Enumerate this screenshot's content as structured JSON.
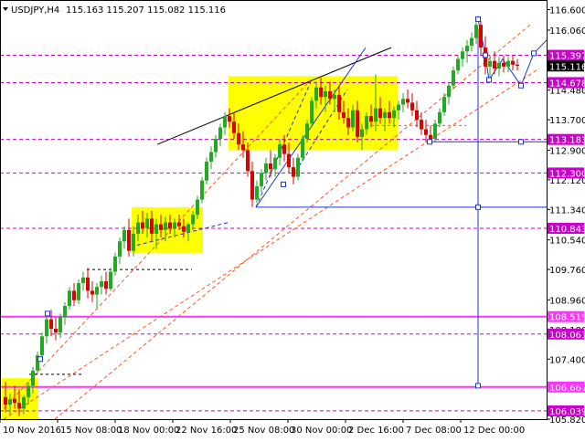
{
  "header": {
    "symbol": "USDJPY,H4",
    "quotes": "115.163 115.207 115.082 115.116"
  },
  "colors": {
    "bull": "#22aa22",
    "bear": "#dd0000",
    "level_dashed": "#cc00cc",
    "level_solid": "#ff33ff",
    "channel": "#ff5522",
    "projection": "#1a35d6",
    "trendline": "#000000",
    "zone": "#ffff00",
    "price_tag_dark": "#1a35d6",
    "price_tag_black": "#000000"
  },
  "chart_data": {
    "type": "candlestick",
    "title": "USDJPY,H4",
    "ylim": [
      105.82,
      116.42
    ],
    "xlim": [
      0,
      590
    ],
    "y_ticks": [
      "116.600",
      "116.060",
      "115.300",
      "114.480",
      "113.700",
      "112.900",
      "112.120",
      "111.340",
      "110.540",
      "109.760",
      "108.960",
      "108.180",
      "107.400",
      "106.620",
      "105.820"
    ],
    "x_ticks": [
      {
        "label": "10 Nov 2016",
        "x": 0
      },
      {
        "label": "15 Nov 08:00",
        "x": 63
      },
      {
        "label": "18 Nov 00:00",
        "x": 126
      },
      {
        "label": "22 Nov 16:00",
        "x": 189
      },
      {
        "label": "25 Nov 08:00",
        "x": 252
      },
      {
        "label": "30 Nov 00:00",
        "x": 315
      },
      {
        "label": "2 Dec 16:00",
        "x": 378
      },
      {
        "label": "7 Dec 08:00",
        "x": 441
      },
      {
        "label": "12 Dec 00:00",
        "x": 504
      }
    ],
    "levels": [
      {
        "price": "115.397",
        "style": "dashed",
        "tag": "dark"
      },
      {
        "price": "114.678",
        "style": "dashed",
        "tag": "dark"
      },
      {
        "price": "113.183",
        "style": "dashed",
        "tag": "dark"
      },
      {
        "price": "112.300",
        "style": "dashed",
        "tag": "dark"
      },
      {
        "price": "110.843",
        "style": "dashed",
        "tag": "dark"
      },
      {
        "price": "108.519",
        "style": "solid",
        "tag": "dark"
      },
      {
        "price": "108.061",
        "style": "dashed",
        "tag": "dark"
      },
      {
        "price": "106.667",
        "style": "solid",
        "tag": "dark"
      },
      {
        "price": "106.039",
        "style": "dashed",
        "tag": "dark"
      }
    ],
    "current_price": "115.116",
    "candles": [
      {
        "x": 6,
        "o": 106.4,
        "h": 106.8,
        "l": 106.0,
        "c": 106.2
      },
      {
        "x": 11,
        "o": 106.2,
        "h": 106.5,
        "l": 105.95,
        "c": 106.35
      },
      {
        "x": 16,
        "o": 106.35,
        "h": 106.7,
        "l": 106.1,
        "c": 106.25
      },
      {
        "x": 21,
        "o": 106.25,
        "h": 106.6,
        "l": 105.9,
        "c": 106.1
      },
      {
        "x": 26,
        "o": 106.1,
        "h": 106.45,
        "l": 105.95,
        "c": 106.4
      },
      {
        "x": 31,
        "o": 106.4,
        "h": 106.8,
        "l": 106.2,
        "c": 106.7
      },
      {
        "x": 36,
        "o": 106.7,
        "h": 107.2,
        "l": 106.5,
        "c": 107.1
      },
      {
        "x": 41,
        "o": 107.1,
        "h": 107.6,
        "l": 107.0,
        "c": 107.5
      },
      {
        "x": 46,
        "o": 107.5,
        "h": 108.1,
        "l": 107.4,
        "c": 108.0
      },
      {
        "x": 51,
        "o": 108.0,
        "h": 108.6,
        "l": 107.8,
        "c": 108.45
      },
      {
        "x": 56,
        "o": 108.45,
        "h": 108.7,
        "l": 108.0,
        "c": 108.2
      },
      {
        "x": 61,
        "o": 108.2,
        "h": 108.5,
        "l": 107.9,
        "c": 108.1
      },
      {
        "x": 66,
        "o": 108.1,
        "h": 108.6,
        "l": 107.95,
        "c": 108.5
      },
      {
        "x": 71,
        "o": 108.5,
        "h": 108.9,
        "l": 108.3,
        "c": 108.8
      },
      {
        "x": 76,
        "o": 108.8,
        "h": 109.3,
        "l": 108.7,
        "c": 109.2
      },
      {
        "x": 81,
        "o": 109.2,
        "h": 109.4,
        "l": 108.8,
        "c": 108.95
      },
      {
        "x": 86,
        "o": 108.95,
        "h": 109.5,
        "l": 108.85,
        "c": 109.4
      },
      {
        "x": 91,
        "o": 109.4,
        "h": 109.7,
        "l": 109.2,
        "c": 109.55
      },
      {
        "x": 96,
        "o": 109.55,
        "h": 109.8,
        "l": 109.0,
        "c": 109.2
      },
      {
        "x": 101,
        "o": 109.2,
        "h": 109.45,
        "l": 108.9,
        "c": 109.1
      },
      {
        "x": 106,
        "o": 109.1,
        "h": 109.4,
        "l": 108.75,
        "c": 109.3
      },
      {
        "x": 111,
        "o": 109.3,
        "h": 109.6,
        "l": 109.1,
        "c": 109.45
      },
      {
        "x": 116,
        "o": 109.45,
        "h": 109.7,
        "l": 109.1,
        "c": 109.25
      },
      {
        "x": 121,
        "o": 109.25,
        "h": 109.8,
        "l": 109.2,
        "c": 109.7
      },
      {
        "x": 126,
        "o": 109.7,
        "h": 110.2,
        "l": 109.6,
        "c": 110.1
      },
      {
        "x": 131,
        "o": 110.1,
        "h": 110.6,
        "l": 109.9,
        "c": 110.5
      },
      {
        "x": 136,
        "o": 110.5,
        "h": 110.9,
        "l": 110.3,
        "c": 110.8
      },
      {
        "x": 141,
        "o": 110.8,
        "h": 111.1,
        "l": 110.1,
        "c": 110.25
      },
      {
        "x": 146,
        "o": 110.25,
        "h": 110.9,
        "l": 110.1,
        "c": 110.7
      },
      {
        "x": 151,
        "o": 110.7,
        "h": 111.2,
        "l": 110.5,
        "c": 111.0
      },
      {
        "x": 156,
        "o": 111.0,
        "h": 111.3,
        "l": 110.7,
        "c": 110.85
      },
      {
        "x": 161,
        "o": 110.85,
        "h": 111.25,
        "l": 110.6,
        "c": 111.1
      },
      {
        "x": 166,
        "o": 111.1,
        "h": 111.3,
        "l": 110.5,
        "c": 110.7
      },
      {
        "x": 171,
        "o": 110.7,
        "h": 111.1,
        "l": 110.3,
        "c": 110.95
      },
      {
        "x": 176,
        "o": 110.95,
        "h": 111.2,
        "l": 110.6,
        "c": 110.8
      },
      {
        "x": 181,
        "o": 110.8,
        "h": 111.15,
        "l": 110.5,
        "c": 111.0
      },
      {
        "x": 186,
        "o": 111.0,
        "h": 111.2,
        "l": 110.7,
        "c": 110.85
      },
      {
        "x": 191,
        "o": 110.85,
        "h": 111.1,
        "l": 110.6,
        "c": 111.0
      },
      {
        "x": 196,
        "o": 111.0,
        "h": 111.2,
        "l": 110.8,
        "c": 110.9
      },
      {
        "x": 201,
        "o": 110.9,
        "h": 111.1,
        "l": 110.6,
        "c": 110.75
      },
      {
        "x": 206,
        "o": 110.75,
        "h": 111.0,
        "l": 110.5,
        "c": 110.95
      },
      {
        "x": 211,
        "o": 110.95,
        "h": 111.3,
        "l": 110.8,
        "c": 111.2
      },
      {
        "x": 216,
        "o": 111.2,
        "h": 111.7,
        "l": 111.1,
        "c": 111.6
      },
      {
        "x": 221,
        "o": 111.6,
        "h": 112.2,
        "l": 111.5,
        "c": 112.1
      },
      {
        "x": 226,
        "o": 112.1,
        "h": 112.7,
        "l": 112.0,
        "c": 112.6
      },
      {
        "x": 231,
        "o": 112.6,
        "h": 113.0,
        "l": 112.4,
        "c": 112.85
      },
      {
        "x": 236,
        "o": 112.85,
        "h": 113.3,
        "l": 112.7,
        "c": 113.2
      },
      {
        "x": 241,
        "o": 113.2,
        "h": 113.6,
        "l": 113.0,
        "c": 113.5
      },
      {
        "x": 246,
        "o": 113.5,
        "h": 113.9,
        "l": 113.3,
        "c": 113.8
      },
      {
        "x": 251,
        "o": 113.8,
        "h": 114.0,
        "l": 113.5,
        "c": 113.65
      },
      {
        "x": 256,
        "o": 113.65,
        "h": 113.9,
        "l": 113.2,
        "c": 113.35
      },
      {
        "x": 261,
        "o": 113.35,
        "h": 113.6,
        "l": 112.9,
        "c": 113.05
      },
      {
        "x": 266,
        "o": 113.05,
        "h": 113.4,
        "l": 112.7,
        "c": 112.9
      },
      {
        "x": 271,
        "o": 112.9,
        "h": 113.1,
        "l": 112.2,
        "c": 112.35
      },
      {
        "x": 276,
        "o": 112.35,
        "h": 112.6,
        "l": 111.4,
        "c": 111.6
      },
      {
        "x": 281,
        "o": 111.6,
        "h": 112.1,
        "l": 111.5,
        "c": 111.95
      },
      {
        "x": 286,
        "o": 111.95,
        "h": 112.4,
        "l": 111.8,
        "c": 112.3
      },
      {
        "x": 291,
        "o": 112.3,
        "h": 112.7,
        "l": 112.1,
        "c": 112.55
      },
      {
        "x": 296,
        "o": 112.55,
        "h": 112.9,
        "l": 112.2,
        "c": 112.4
      },
      {
        "x": 301,
        "o": 112.4,
        "h": 112.8,
        "l": 112.2,
        "c": 112.7
      },
      {
        "x": 306,
        "o": 112.7,
        "h": 113.2,
        "l": 112.5,
        "c": 113.05
      },
      {
        "x": 311,
        "o": 113.05,
        "h": 113.3,
        "l": 112.6,
        "c": 112.8
      },
      {
        "x": 316,
        "o": 112.8,
        "h": 113.1,
        "l": 112.3,
        "c": 112.45
      },
      {
        "x": 321,
        "o": 112.45,
        "h": 112.7,
        "l": 112.0,
        "c": 112.2
      },
      {
        "x": 326,
        "o": 112.2,
        "h": 112.8,
        "l": 112.1,
        "c": 112.7
      },
      {
        "x": 331,
        "o": 112.7,
        "h": 113.3,
        "l": 112.6,
        "c": 113.2
      },
      {
        "x": 336,
        "o": 113.2,
        "h": 113.7,
        "l": 113.1,
        "c": 113.6
      },
      {
        "x": 341,
        "o": 113.6,
        "h": 114.3,
        "l": 113.5,
        "c": 114.2
      },
      {
        "x": 346,
        "o": 114.2,
        "h": 114.7,
        "l": 114.0,
        "c": 114.55
      },
      {
        "x": 351,
        "o": 114.55,
        "h": 114.8,
        "l": 114.1,
        "c": 114.3
      },
      {
        "x": 356,
        "o": 114.3,
        "h": 114.6,
        "l": 113.9,
        "c": 114.45
      },
      {
        "x": 361,
        "o": 114.45,
        "h": 114.7,
        "l": 114.1,
        "c": 114.25
      },
      {
        "x": 366,
        "o": 114.25,
        "h": 114.5,
        "l": 113.9,
        "c": 114.35
      },
      {
        "x": 371,
        "o": 114.35,
        "h": 114.6,
        "l": 113.7,
        "c": 113.9
      },
      {
        "x": 376,
        "o": 113.9,
        "h": 114.2,
        "l": 113.6,
        "c": 113.75
      },
      {
        "x": 381,
        "o": 113.75,
        "h": 114.0,
        "l": 113.3,
        "c": 113.5
      },
      {
        "x": 386,
        "o": 113.5,
        "h": 114.1,
        "l": 113.4,
        "c": 113.95
      },
      {
        "x": 391,
        "o": 113.95,
        "h": 114.2,
        "l": 113.1,
        "c": 113.25
      },
      {
        "x": 396,
        "o": 113.25,
        "h": 113.6,
        "l": 112.9,
        "c": 113.45
      },
      {
        "x": 401,
        "o": 113.45,
        "h": 113.9,
        "l": 113.3,
        "c": 113.8
      },
      {
        "x": 406,
        "o": 113.8,
        "h": 114.1,
        "l": 113.5,
        "c": 113.65
      },
      {
        "x": 411,
        "o": 113.65,
        "h": 114.9,
        "l": 113.4,
        "c": 114.0
      },
      {
        "x": 416,
        "o": 114.0,
        "h": 114.3,
        "l": 113.6,
        "c": 113.75
      },
      {
        "x": 421,
        "o": 113.75,
        "h": 114.0,
        "l": 113.4,
        "c": 113.9
      },
      {
        "x": 426,
        "o": 113.9,
        "h": 114.2,
        "l": 113.6,
        "c": 113.75
      },
      {
        "x": 431,
        "o": 113.75,
        "h": 114.05,
        "l": 113.5,
        "c": 113.95
      },
      {
        "x": 436,
        "o": 113.95,
        "h": 114.2,
        "l": 113.7,
        "c": 114.1
      },
      {
        "x": 441,
        "o": 114.1,
        "h": 114.4,
        "l": 113.9,
        "c": 114.25
      },
      {
        "x": 446,
        "o": 114.25,
        "h": 114.5,
        "l": 114.0,
        "c": 114.15
      },
      {
        "x": 451,
        "o": 114.15,
        "h": 114.4,
        "l": 113.8,
        "c": 113.95
      },
      {
        "x": 456,
        "o": 113.95,
        "h": 114.2,
        "l": 113.5,
        "c": 113.7
      },
      {
        "x": 461,
        "o": 113.7,
        "h": 113.9,
        "l": 113.3,
        "c": 113.45
      },
      {
        "x": 466,
        "o": 113.45,
        "h": 113.7,
        "l": 113.1,
        "c": 113.3
      },
      {
        "x": 471,
        "o": 113.3,
        "h": 113.55,
        "l": 113.05,
        "c": 113.2
      },
      {
        "x": 476,
        "o": 113.2,
        "h": 113.7,
        "l": 113.1,
        "c": 113.6
      },
      {
        "x": 481,
        "o": 113.6,
        "h": 114.0,
        "l": 113.5,
        "c": 113.9
      },
      {
        "x": 486,
        "o": 113.9,
        "h": 114.4,
        "l": 113.8,
        "c": 114.3
      },
      {
        "x": 491,
        "o": 114.3,
        "h": 114.7,
        "l": 114.1,
        "c": 114.6
      },
      {
        "x": 496,
        "o": 114.6,
        "h": 115.1,
        "l": 114.5,
        "c": 115.0
      },
      {
        "x": 501,
        "o": 115.0,
        "h": 115.4,
        "l": 114.9,
        "c": 115.3
      },
      {
        "x": 506,
        "o": 115.3,
        "h": 115.6,
        "l": 115.1,
        "c": 115.5
      },
      {
        "x": 511,
        "o": 115.5,
        "h": 115.8,
        "l": 115.2,
        "c": 115.65
      },
      {
        "x": 516,
        "o": 115.65,
        "h": 116.0,
        "l": 115.5,
        "c": 115.85
      },
      {
        "x": 521,
        "o": 115.85,
        "h": 116.35,
        "l": 115.7,
        "c": 116.2
      },
      {
        "x": 526,
        "o": 116.2,
        "h": 116.3,
        "l": 115.4,
        "c": 115.6
      },
      {
        "x": 531,
        "o": 115.6,
        "h": 115.9,
        "l": 114.9,
        "c": 115.1
      },
      {
        "x": 536,
        "o": 115.1,
        "h": 115.4,
        "l": 114.8,
        "c": 115.25
      },
      {
        "x": 541,
        "o": 115.25,
        "h": 115.5,
        "l": 114.9,
        "c": 115.05
      },
      {
        "x": 546,
        "o": 115.05,
        "h": 115.35,
        "l": 114.85,
        "c": 115.2
      },
      {
        "x": 551,
        "o": 115.2,
        "h": 115.4,
        "l": 114.95,
        "c": 115.1
      },
      {
        "x": 556,
        "o": 115.1,
        "h": 115.35,
        "l": 114.95,
        "c": 115.25
      },
      {
        "x": 561,
        "o": 115.25,
        "h": 115.4,
        "l": 115.0,
        "c": 115.15
      },
      {
        "x": 566,
        "o": 115.15,
        "h": 115.3,
        "l": 115.0,
        "c": 115.12
      }
    ],
    "zones": [
      {
        "x1": 2,
        "x2": 42,
        "p_top": 106.9,
        "p_bot": 105.82
      },
      {
        "x1": 144,
        "x2": 222,
        "p_top": 111.4,
        "p_bot": 110.2
      },
      {
        "x1": 250,
        "x2": 435,
        "p_top": 114.85,
        "p_bot": 112.9
      }
    ],
    "trendlines": [
      {
        "x1": 172,
        "p1": 113.05,
        "x2": 428,
        "p2": 115.6,
        "style": "solid",
        "color": "trendline"
      },
      {
        "x1": 4,
        "p1": 106.1,
        "x2": 340,
        "p2": 114.75,
        "style": "dashed",
        "color": "channel"
      },
      {
        "x1": 4,
        "p1": 105.82,
        "x2": 590,
        "p2": 115.05,
        "style": "dashed",
        "color": "channel"
      },
      {
        "x1": 60,
        "p1": 105.82,
        "x2": 580,
        "p2": 116.2,
        "style": "dashed",
        "color": "channel"
      },
      {
        "x1": 280,
        "p1": 111.4,
        "x2": 400,
        "p2": 115.6,
        "style": "solid",
        "color": "projection"
      },
      {
        "x1": 280,
        "p1": 111.4,
        "x2": 340,
        "p2": 114.7,
        "style": "dashed",
        "color": "projection"
      },
      {
        "x1": 320,
        "p1": 112.2,
        "x2": 380,
        "p2": 114.5,
        "style": "dashed",
        "color": "projection"
      },
      {
        "x1": 150,
        "p1": 110.4,
        "x2": 250,
        "p2": 111.0,
        "style": "dashed",
        "color": "projection"
      }
    ],
    "horizontal_segments": [
      {
        "x1": 32,
        "x2": 90,
        "p": 107.0,
        "style": "dashed",
        "color": "#000000"
      },
      {
        "x1": 95,
        "x2": 210,
        "p": 109.76,
        "style": "dashed",
        "color": "#000000"
      },
      {
        "x1": 280,
        "x2": 598,
        "p": 111.4,
        "style": "solid",
        "color": "projection"
      },
      {
        "x1": 470,
        "x2": 598,
        "p": 113.12,
        "style": "solid",
        "color": "projection"
      },
      {
        "x1": 400,
        "x2": 510,
        "p": 113.55,
        "style": "dashed",
        "color": "channel"
      }
    ],
    "vertical_segments": [
      {
        "x": 523,
        "p1": 106.7,
        "p2": 116.1,
        "color": "projection"
      }
    ],
    "projection_path": [
      {
        "x": 523,
        "p": 116.35
      },
      {
        "x": 531,
        "p": 115.4
      },
      {
        "x": 535,
        "p": 114.75
      },
      {
        "x": 550,
        "p": 115.3
      },
      {
        "x": 570,
        "p": 114.6
      },
      {
        "x": 584,
        "p": 115.45
      },
      {
        "x": 598,
        "p": 115.8
      }
    ],
    "markers": [
      {
        "x": 523,
        "p": 116.35
      },
      {
        "x": 531,
        "p": 115.4
      },
      {
        "x": 535,
        "p": 114.75
      },
      {
        "x": 570,
        "p": 114.6
      },
      {
        "x": 584,
        "p": 115.45
      },
      {
        "x": 523,
        "p": 111.4
      },
      {
        "x": 523,
        "p": 106.7
      },
      {
        "x": 470,
        "p": 113.12
      },
      {
        "x": 570,
        "p": 113.12
      },
      {
        "x": 44,
        "p": 107.4
      },
      {
        "x": 52,
        "p": 108.6
      },
      {
        "x": 310,
        "p": 112.0
      }
    ]
  }
}
